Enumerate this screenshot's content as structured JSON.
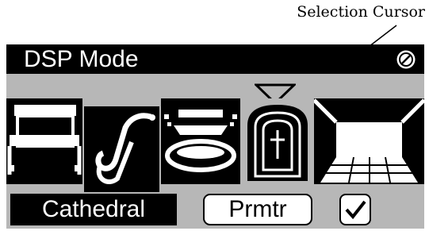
{
  "callout": {
    "label": "Selection Cursor"
  },
  "screen": {
    "title": "DSP Mode",
    "title_icon": "circle-slash-icon",
    "modes": [
      {
        "icon": "hall-stage-icon",
        "selected": false
      },
      {
        "icon": "saxophone-icon",
        "selected": false
      },
      {
        "icon": "stadium-icon",
        "selected": false
      },
      {
        "icon": "cathedral-cross-icon",
        "selected": true
      },
      {
        "icon": "room-perspective-icon",
        "selected": false
      }
    ],
    "current_mode": "Cathedral",
    "param_button": "Prmtr",
    "ok_button_icon": "checkmark-icon",
    "colors": {
      "lcd_background": "#b7b7b7",
      "inverse": "#000000"
    }
  }
}
